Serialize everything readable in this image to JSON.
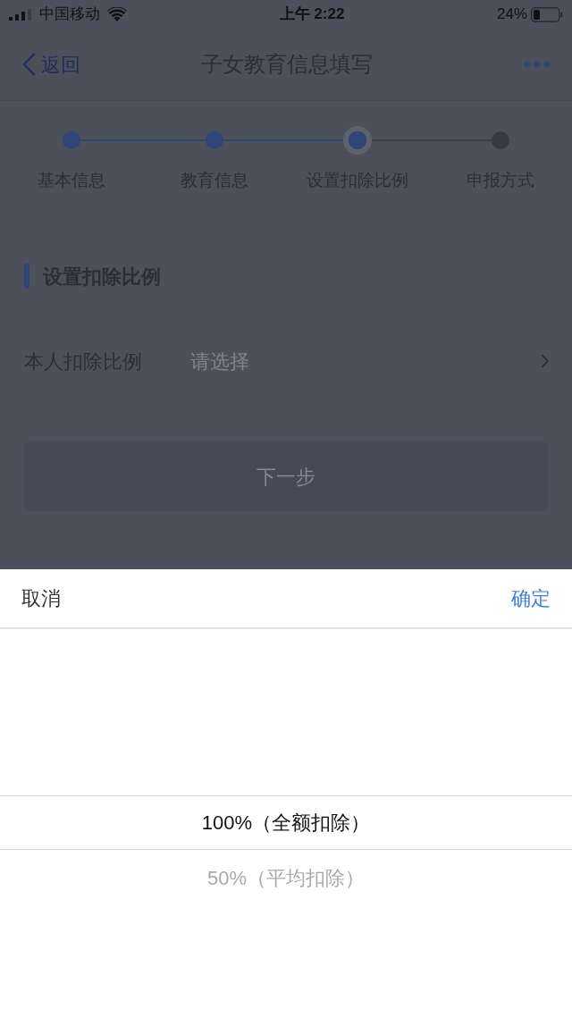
{
  "status_bar": {
    "carrier": "中国移动",
    "time": "上午 2:22",
    "battery": "24%"
  },
  "nav_bar": {
    "back": "返回",
    "title": "子女教育信息填写"
  },
  "steps": [
    {
      "label": "基本信息",
      "completed": true,
      "selected": false
    },
    {
      "label": "教育信息",
      "completed": true,
      "selected": false
    },
    {
      "label": "设置扣除比例",
      "completed": false,
      "selected": true
    },
    {
      "label": "申报方式",
      "completed": false,
      "selected": false
    }
  ],
  "section": {
    "title": "设置扣除比例"
  },
  "form": {
    "fields": [
      {
        "label": "本人扣除比例",
        "placeholder": "请选择"
      }
    ],
    "next_button": {
      "label": "下一步",
      "disabled": true
    }
  },
  "picker": {
    "cancel": "取消",
    "confirm": "确定",
    "options": [
      {
        "label": "100%（全额扣除）",
        "selected": true
      },
      {
        "label": "50%（平均扣除）",
        "selected": false
      }
    ]
  }
}
